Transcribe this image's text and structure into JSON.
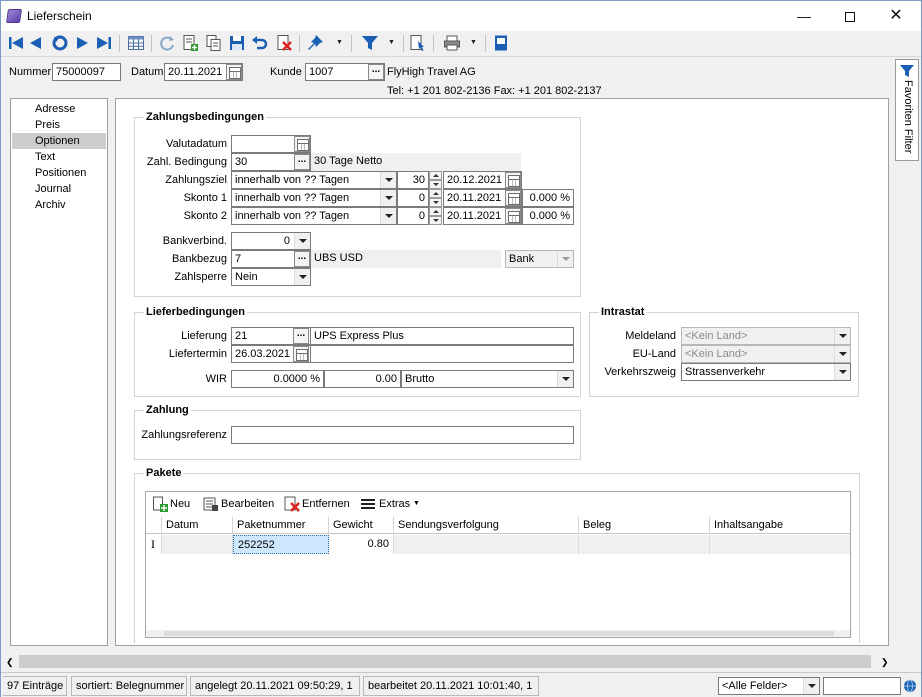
{
  "window": {
    "title": "Lieferschein"
  },
  "header": {
    "nummer_label": "Nummer",
    "nummer_value": "75000097",
    "datum_label": "Datum",
    "datum_value": "20.11.2021",
    "kunde_label": "Kunde",
    "kunde_value": "1007",
    "kunde_name": "FlyHigh Travel AG",
    "kunde_contact": "Tel: +1 201 802-2136   Fax: +1 201 802-2137"
  },
  "nav": {
    "items": [
      {
        "label": "Adresse"
      },
      {
        "label": "Preis"
      },
      {
        "label": "Optionen"
      },
      {
        "label": "Text"
      },
      {
        "label": "Positionen"
      },
      {
        "label": "Journal"
      },
      {
        "label": "Archiv"
      }
    ],
    "selected": "Optionen"
  },
  "zahlungsbedingungen": {
    "title": "Zahlungsbedingungen",
    "valutadatum_label": "Valutadatum",
    "valutadatum_value": "",
    "bedingung_label": "Zahl. Bedingung",
    "bedingung_value": "30",
    "bedingung_text": "30 Tage Netto",
    "ziel_label": "Zahlungsziel",
    "ziel_mode": "innerhalb von ?? Tagen",
    "ziel_days": "30",
    "ziel_date": "20.12.2021",
    "skonto1_label": "Skonto 1",
    "skonto1_mode": "innerhalb von ?? Tagen",
    "skonto1_days": "0",
    "skonto1_date": "20.11.2021",
    "skonto1_pct": "0.000 %",
    "skonto2_label": "Skonto 2",
    "skonto2_mode": "innerhalb von ?? Tagen",
    "skonto2_days": "0",
    "skonto2_date": "20.11.2021",
    "skonto2_pct": "0.000 %",
    "bankverbind_label": "Bankverbind.",
    "bankverbind_value": "0",
    "bankbezug_label": "Bankbezug",
    "bankbezug_value": "7",
    "bankbezug_text": "UBS USD",
    "bankbezug_type": "Bank",
    "zahlsperre_label": "Zahlsperre",
    "zahlsperre_value": "Nein"
  },
  "lieferbedingungen": {
    "title": "Lieferbedingungen",
    "lieferung_label": "Lieferung",
    "lieferung_value": "21",
    "lieferung_text": "UPS Express Plus",
    "liefertermin_label": "Liefertermin",
    "liefertermin_value": "26.03.2021",
    "wir_label": "WIR",
    "wir_pct": "0.0000 %",
    "wir_amount": "0.00",
    "wir_mode": "Brutto"
  },
  "intrastat": {
    "title": "Intrastat",
    "meldeland_label": "Meldeland",
    "meldeland_value": "<Kein Land>",
    "euland_label": "EU-Land",
    "euland_value": "<Kein Land>",
    "verkehrszweig_label": "Verkehrszweig",
    "verkehrszweig_value": "Strassenverkehr"
  },
  "zahlung": {
    "title": "Zahlung",
    "referenz_label": "Zahlungsreferenz",
    "referenz_value": ""
  },
  "pakete": {
    "title": "Pakete",
    "tools": {
      "neu": "Neu",
      "bearbeiten": "Bearbeiten",
      "entfernen": "Entfernen",
      "extras": "Extras"
    },
    "columns": [
      "Datum",
      "Paketnummer",
      "Gewicht",
      "Sendungsverfolgung",
      "Beleg",
      "Inhaltsangabe"
    ],
    "rows": [
      {
        "datum": "",
        "paketnummer": "252252",
        "gewicht": "0.80",
        "sendungsverfolgung": "",
        "beleg": "",
        "inhaltsangabe": ""
      }
    ]
  },
  "side_tab": {
    "label": "Favoriten Filter"
  },
  "status": {
    "count": "97 Einträge",
    "sort": "sortiert: Belegnummer",
    "created": "angelegt 20.11.2021 09:50:29,  1",
    "edited": "bearbeitet 20.11.2021 10:01:40,  1",
    "filter_value": "<Alle Felder>"
  },
  "colors": {
    "toolbar_blue": "#1a5fb4",
    "selection": "#cde8ff",
    "accent_red": "#d22",
    "nav_selected": "#cdcdcd"
  }
}
